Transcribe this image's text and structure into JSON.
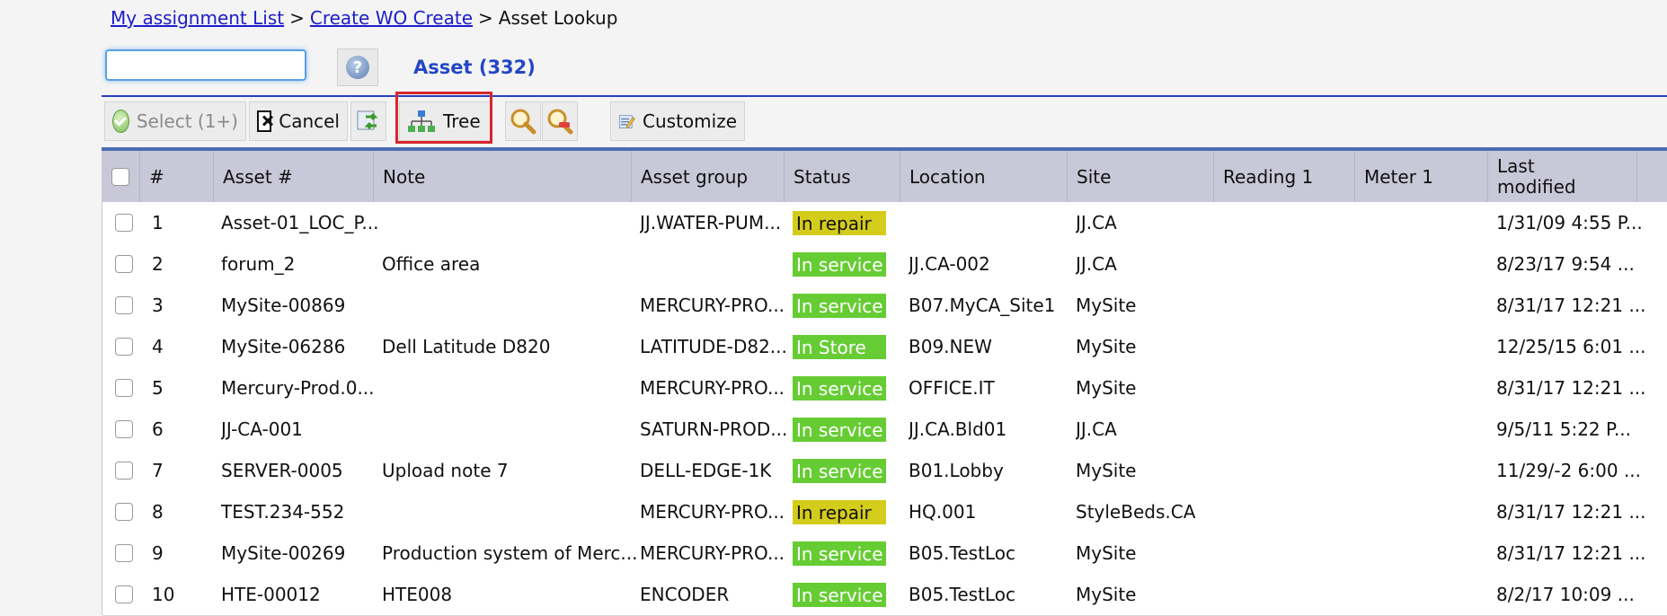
{
  "breadcrumb": {
    "link1": "My assignment List",
    "link2": "Create WO Create",
    "current": "Asset Lookup",
    "separator": ">"
  },
  "search": {
    "value": "",
    "placeholder": ""
  },
  "asset_title": "Asset (332)",
  "toolbar": {
    "select_label": "Select (1+)",
    "cancel_label": "Cancel",
    "tree_label": "Tree",
    "customize_label": "Customize"
  },
  "columns": [
    "#",
    "Asset #",
    "Note",
    "Asset group",
    "Status",
    "Location",
    "Site",
    "Reading 1",
    "Meter 1",
    "Last\nmodified"
  ],
  "colors": {
    "in_service": "#66cc33",
    "in_repair": "#d4cc1a",
    "link": "#1c1ccc",
    "accent": "#2347c4",
    "highlight": "#d9262c"
  },
  "rows": [
    {
      "num": "1",
      "asset": "Asset-01_LOC_P...",
      "note": "",
      "group": "JJ.WATER-PUM...",
      "status": "In repair",
      "status_type": "rep",
      "location": "",
      "site": "JJ.CA",
      "reading": "",
      "meter": "",
      "modified": "1/31/09 4:55 P..."
    },
    {
      "num": "2",
      "asset": "forum_2",
      "note": "Office area",
      "group": "",
      "status": "In service",
      "status_type": "svc",
      "location": "JJ.CA-002",
      "site": "JJ.CA",
      "reading": "",
      "meter": "",
      "modified": "8/23/17 9:54 ..."
    },
    {
      "num": "3",
      "asset": "MySite-00869",
      "note": "",
      "group": "MERCURY-PRO...",
      "status": "In service",
      "status_type": "svc",
      "location": "B07.MyCA_Site1",
      "site": "MySite",
      "reading": "",
      "meter": "",
      "modified": "8/31/17 12:21 ..."
    },
    {
      "num": "4",
      "asset": "MySite-06286",
      "note": "Dell Latitude D820",
      "group": "LATITUDE-D82...",
      "status": "In Store",
      "status_type": "svc",
      "location": "B09.NEW",
      "site": "MySite",
      "reading": "",
      "meter": "",
      "modified": "12/25/15 6:01 ..."
    },
    {
      "num": "5",
      "asset": "Mercury-Prod.0...",
      "note": "",
      "group": "MERCURY-PRO...",
      "status": "In service",
      "status_type": "svc",
      "location": "OFFICE.IT",
      "site": "MySite",
      "reading": "",
      "meter": "",
      "modified": "8/31/17 12:21 ..."
    },
    {
      "num": "6",
      "asset": "JJ-CA-001",
      "note": "",
      "group": "SATURN-PROD...",
      "status": "In service",
      "status_type": "svc",
      "location": "JJ.CA.Bld01",
      "site": "JJ.CA",
      "reading": "",
      "meter": "",
      "modified": "9/5/11 5:22 P..."
    },
    {
      "num": "7",
      "asset": "SERVER-0005",
      "note": "Upload note 7",
      "group": "DELL-EDGE-1K",
      "status": "In service",
      "status_type": "svc",
      "location": "B01.Lobby",
      "site": "MySite",
      "reading": "",
      "meter": "",
      "modified": "11/29/-2 6:00 ..."
    },
    {
      "num": "8",
      "asset": "TEST.234-552",
      "note": "",
      "group": "MERCURY-PRO...",
      "status": "In repair",
      "status_type": "rep",
      "location": "HQ.001",
      "site": "StyleBeds.CA",
      "reading": "",
      "meter": "",
      "modified": "8/31/17 12:21 ..."
    },
    {
      "num": "9",
      "asset": "MySite-00269",
      "note": "Production system of Merc...",
      "group": "MERCURY-PRO...",
      "status": "In service",
      "status_type": "svc",
      "location": "B05.TestLoc",
      "site": "MySite",
      "reading": "",
      "meter": "",
      "modified": "8/31/17 12:21 ..."
    },
    {
      "num": "10",
      "asset": "HTE-00012",
      "note": "HTE008",
      "group": "ENCODER",
      "status": "In service",
      "status_type": "svc",
      "location": "B05.TestLoc",
      "site": "MySite",
      "reading": "",
      "meter": "",
      "modified": "8/2/17 10:09 ..."
    }
  ]
}
